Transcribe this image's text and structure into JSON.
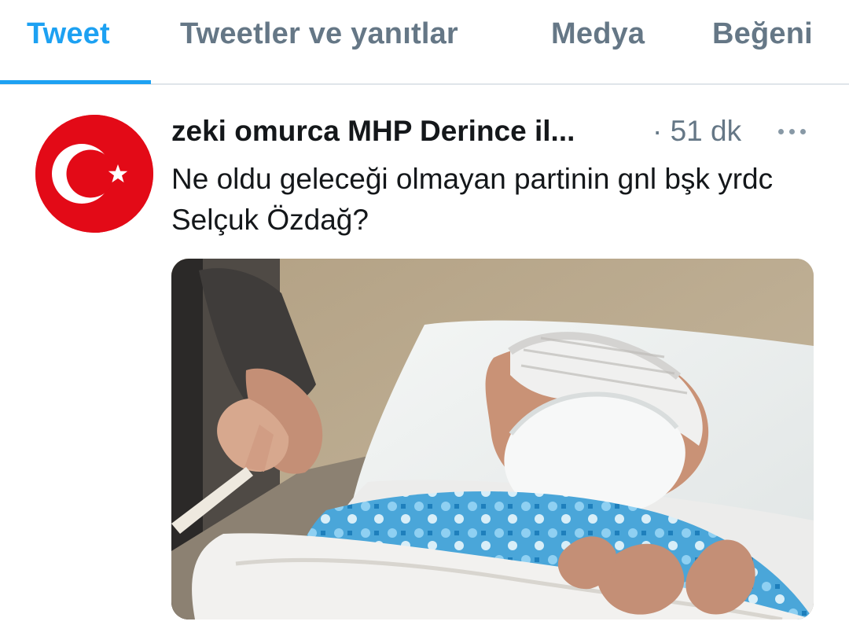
{
  "tabs": [
    {
      "label": "Tweet",
      "active": true
    },
    {
      "label": "Tweetler ve yanıtlar",
      "active": false
    },
    {
      "label": "Medya",
      "active": false
    },
    {
      "label": "Beğeni",
      "active": false
    }
  ],
  "tweet": {
    "display_name": "zeki omurca MHP Derince il...",
    "timestamp": "· 51 dk",
    "text": "Ne oldu geleceği olmayan partinin gnl bşk yrdc Selçuk Özdağ?",
    "icons": {
      "more": "more-horizontal-icon",
      "avatar": "turkish-flag-avatar"
    }
  },
  "colors": {
    "accent": "#1da1f2",
    "muted": "#657786",
    "text": "#14171a",
    "divider": "#dfe5ea",
    "flag_red": "#e30a17"
  }
}
